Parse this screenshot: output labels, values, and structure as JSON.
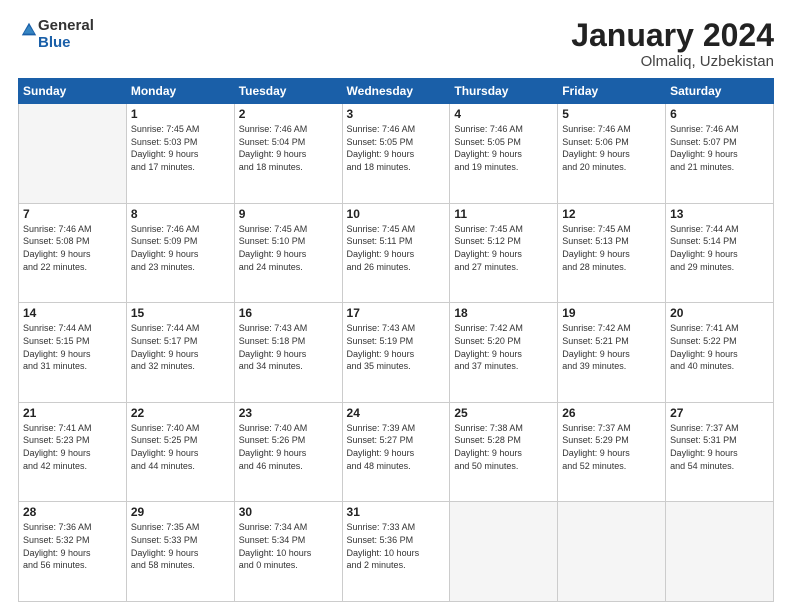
{
  "logo": {
    "general": "General",
    "blue": "Blue"
  },
  "title": "January 2024",
  "location": "Olmaliq, Uzbekistan",
  "days_header": [
    "Sunday",
    "Monday",
    "Tuesday",
    "Wednesday",
    "Thursday",
    "Friday",
    "Saturday"
  ],
  "weeks": [
    [
      {
        "day": "",
        "sunrise": "",
        "sunset": "",
        "daylight": ""
      },
      {
        "day": "1",
        "sunrise": "Sunrise: 7:45 AM",
        "sunset": "Sunset: 5:03 PM",
        "daylight": "Daylight: 9 hours and 17 minutes."
      },
      {
        "day": "2",
        "sunrise": "Sunrise: 7:46 AM",
        "sunset": "Sunset: 5:04 PM",
        "daylight": "Daylight: 9 hours and 18 minutes."
      },
      {
        "day": "3",
        "sunrise": "Sunrise: 7:46 AM",
        "sunset": "Sunset: 5:05 PM",
        "daylight": "Daylight: 9 hours and 18 minutes."
      },
      {
        "day": "4",
        "sunrise": "Sunrise: 7:46 AM",
        "sunset": "Sunset: 5:05 PM",
        "daylight": "Daylight: 9 hours and 19 minutes."
      },
      {
        "day": "5",
        "sunrise": "Sunrise: 7:46 AM",
        "sunset": "Sunset: 5:06 PM",
        "daylight": "Daylight: 9 hours and 20 minutes."
      },
      {
        "day": "6",
        "sunrise": "Sunrise: 7:46 AM",
        "sunset": "Sunset: 5:07 PM",
        "daylight": "Daylight: 9 hours and 21 minutes."
      }
    ],
    [
      {
        "day": "7",
        "sunrise": "Sunrise: 7:46 AM",
        "sunset": "Sunset: 5:08 PM",
        "daylight": "Daylight: 9 hours and 22 minutes."
      },
      {
        "day": "8",
        "sunrise": "Sunrise: 7:46 AM",
        "sunset": "Sunset: 5:09 PM",
        "daylight": "Daylight: 9 hours and 23 minutes."
      },
      {
        "day": "9",
        "sunrise": "Sunrise: 7:45 AM",
        "sunset": "Sunset: 5:10 PM",
        "daylight": "Daylight: 9 hours and 24 minutes."
      },
      {
        "day": "10",
        "sunrise": "Sunrise: 7:45 AM",
        "sunset": "Sunset: 5:11 PM",
        "daylight": "Daylight: 9 hours and 26 minutes."
      },
      {
        "day": "11",
        "sunrise": "Sunrise: 7:45 AM",
        "sunset": "Sunset: 5:12 PM",
        "daylight": "Daylight: 9 hours and 27 minutes."
      },
      {
        "day": "12",
        "sunrise": "Sunrise: 7:45 AM",
        "sunset": "Sunset: 5:13 PM",
        "daylight": "Daylight: 9 hours and 28 minutes."
      },
      {
        "day": "13",
        "sunrise": "Sunrise: 7:44 AM",
        "sunset": "Sunset: 5:14 PM",
        "daylight": "Daylight: 9 hours and 29 minutes."
      }
    ],
    [
      {
        "day": "14",
        "sunrise": "Sunrise: 7:44 AM",
        "sunset": "Sunset: 5:15 PM",
        "daylight": "Daylight: 9 hours and 31 minutes."
      },
      {
        "day": "15",
        "sunrise": "Sunrise: 7:44 AM",
        "sunset": "Sunset: 5:17 PM",
        "daylight": "Daylight: 9 hours and 32 minutes."
      },
      {
        "day": "16",
        "sunrise": "Sunrise: 7:43 AM",
        "sunset": "Sunset: 5:18 PM",
        "daylight": "Daylight: 9 hours and 34 minutes."
      },
      {
        "day": "17",
        "sunrise": "Sunrise: 7:43 AM",
        "sunset": "Sunset: 5:19 PM",
        "daylight": "Daylight: 9 hours and 35 minutes."
      },
      {
        "day": "18",
        "sunrise": "Sunrise: 7:42 AM",
        "sunset": "Sunset: 5:20 PM",
        "daylight": "Daylight: 9 hours and 37 minutes."
      },
      {
        "day": "19",
        "sunrise": "Sunrise: 7:42 AM",
        "sunset": "Sunset: 5:21 PM",
        "daylight": "Daylight: 9 hours and 39 minutes."
      },
      {
        "day": "20",
        "sunrise": "Sunrise: 7:41 AM",
        "sunset": "Sunset: 5:22 PM",
        "daylight": "Daylight: 9 hours and 40 minutes."
      }
    ],
    [
      {
        "day": "21",
        "sunrise": "Sunrise: 7:41 AM",
        "sunset": "Sunset: 5:23 PM",
        "daylight": "Daylight: 9 hours and 42 minutes."
      },
      {
        "day": "22",
        "sunrise": "Sunrise: 7:40 AM",
        "sunset": "Sunset: 5:25 PM",
        "daylight": "Daylight: 9 hours and 44 minutes."
      },
      {
        "day": "23",
        "sunrise": "Sunrise: 7:40 AM",
        "sunset": "Sunset: 5:26 PM",
        "daylight": "Daylight: 9 hours and 46 minutes."
      },
      {
        "day": "24",
        "sunrise": "Sunrise: 7:39 AM",
        "sunset": "Sunset: 5:27 PM",
        "daylight": "Daylight: 9 hours and 48 minutes."
      },
      {
        "day": "25",
        "sunrise": "Sunrise: 7:38 AM",
        "sunset": "Sunset: 5:28 PM",
        "daylight": "Daylight: 9 hours and 50 minutes."
      },
      {
        "day": "26",
        "sunrise": "Sunrise: 7:37 AM",
        "sunset": "Sunset: 5:29 PM",
        "daylight": "Daylight: 9 hours and 52 minutes."
      },
      {
        "day": "27",
        "sunrise": "Sunrise: 7:37 AM",
        "sunset": "Sunset: 5:31 PM",
        "daylight": "Daylight: 9 hours and 54 minutes."
      }
    ],
    [
      {
        "day": "28",
        "sunrise": "Sunrise: 7:36 AM",
        "sunset": "Sunset: 5:32 PM",
        "daylight": "Daylight: 9 hours and 56 minutes."
      },
      {
        "day": "29",
        "sunrise": "Sunrise: 7:35 AM",
        "sunset": "Sunset: 5:33 PM",
        "daylight": "Daylight: 9 hours and 58 minutes."
      },
      {
        "day": "30",
        "sunrise": "Sunrise: 7:34 AM",
        "sunset": "Sunset: 5:34 PM",
        "daylight": "Daylight: 10 hours and 0 minutes."
      },
      {
        "day": "31",
        "sunrise": "Sunrise: 7:33 AM",
        "sunset": "Sunset: 5:36 PM",
        "daylight": "Daylight: 10 hours and 2 minutes."
      },
      {
        "day": "",
        "sunrise": "",
        "sunset": "",
        "daylight": ""
      },
      {
        "day": "",
        "sunrise": "",
        "sunset": "",
        "daylight": ""
      },
      {
        "day": "",
        "sunrise": "",
        "sunset": "",
        "daylight": ""
      }
    ]
  ]
}
